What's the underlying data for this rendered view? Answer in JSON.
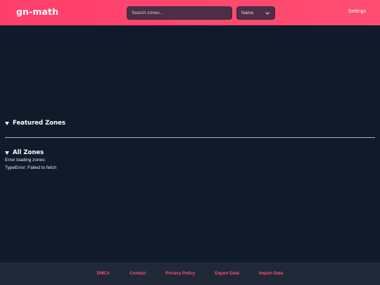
{
  "header": {
    "logo": "gn-math",
    "search_placeholder": "Search zones...",
    "sort_selected": "Name",
    "settings_label": "Settings"
  },
  "main": {
    "featured_title": "Featured Zones",
    "all_title": "All Zones",
    "error_line1": "Error loading zones:",
    "error_line2": "TypeError: Failed to fetch"
  },
  "footer": {
    "links": [
      "DMCA",
      "Contact",
      "Privacy Policy",
      "Export Data",
      "Import Data"
    ]
  },
  "colors": {
    "header_bg": "#ff4d72",
    "page_bg": "#111a2b",
    "footer_bg": "#1f2937",
    "accent": "#ff4d72"
  }
}
